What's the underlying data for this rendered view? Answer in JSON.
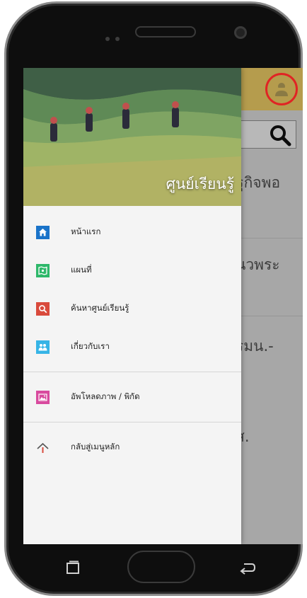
{
  "app": {
    "drawer_title": "ศูนย์เรียนรู้",
    "background_items": [
      "ฐกิจพอ",
      "นวพระ",
      "รมน.-",
      "ส.",
      "."
    ]
  },
  "menu": {
    "items": [
      {
        "label": "หน้าแรก",
        "icon": "home-icon",
        "color": "#1a73c9"
      },
      {
        "label": "แผนที่",
        "icon": "map-icon",
        "color": "#2eb86a"
      },
      {
        "label": "ค้นหาศูนย์เรียนรู้",
        "icon": "search-icon",
        "color": "#d94a3c"
      },
      {
        "label": "เกี่ยวกับเรา",
        "icon": "people-icon",
        "color": "#36b4e6"
      }
    ],
    "upload": {
      "label": "อัพโหลดภาพ / พิกัด",
      "icon": "image-icon",
      "color": "#d84a9e"
    },
    "back": {
      "label": "กลับสู่เมนูหลัก",
      "icon": "arrow-up-icon"
    }
  },
  "colors": {
    "topbar": "#b59c4d",
    "profile_ring": "#e02424",
    "drawer_bg": "#f4f4f4"
  }
}
